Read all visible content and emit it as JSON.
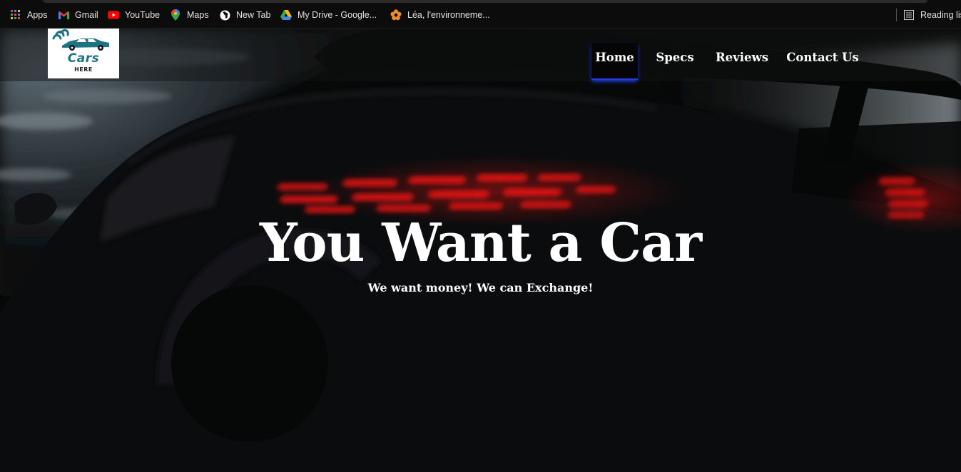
{
  "bookmarks": [
    {
      "label": "Apps",
      "icon": "apps-grid-icon"
    },
    {
      "label": "Gmail",
      "icon": "gmail-icon"
    },
    {
      "label": "YouTube",
      "icon": "youtube-icon"
    },
    {
      "label": "Maps",
      "icon": "maps-pin-icon"
    },
    {
      "label": "New Tab",
      "icon": "globe-icon"
    },
    {
      "label": "My Drive - Google...",
      "icon": "google-drive-icon"
    },
    {
      "label": "Léa, l'environneme...",
      "icon": "flower-icon"
    },
    {
      "label": "Reading list",
      "icon": "reading-list-icon"
    }
  ],
  "site": {
    "logo": {
      "text": "Cars",
      "subtext": "HERE"
    },
    "nav": [
      {
        "label": "Home",
        "active": true
      },
      {
        "label": "Specs",
        "active": false
      },
      {
        "label": "Reviews",
        "active": false
      },
      {
        "label": "Contact Us",
        "active": false
      }
    ],
    "hero": {
      "title": "You Want a Car",
      "subtitle": "We want money! We can Exchange!"
    }
  },
  "colors": {
    "nav_active_glow": "#1c47ff",
    "taillight_red": "#ff1414",
    "logo_teal": "#1d7283"
  }
}
